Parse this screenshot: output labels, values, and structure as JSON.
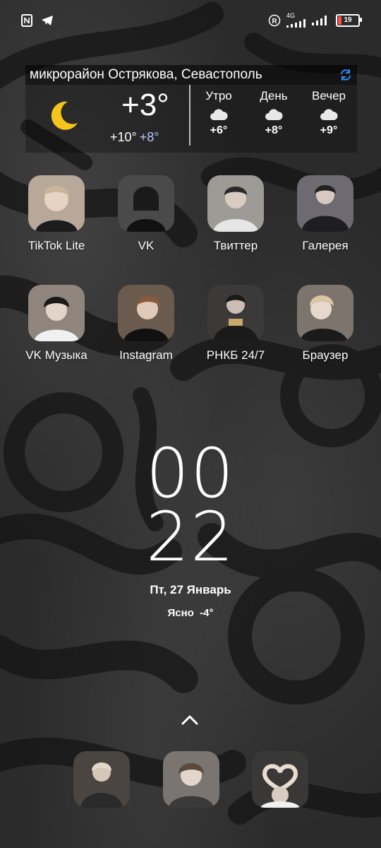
{
  "status_bar": {
    "left_icons": [
      "nfc-icon",
      "telegram-icon"
    ],
    "network_label": "4G",
    "battery_level": 19,
    "battery_text": "19"
  },
  "weather": {
    "location": "микрорайон Острякова, Севастополь",
    "current_temp": "+3°",
    "temp_high": "+10°",
    "temp_low": "+8°",
    "forecast": [
      {
        "label": "Утро",
        "temp": "+6°"
      },
      {
        "label": "День",
        "temp": "+8°"
      },
      {
        "label": "Вечер",
        "temp": "+9°"
      }
    ]
  },
  "apps": [
    {
      "label": "TikTok Lite",
      "color": "#b8a89a"
    },
    {
      "label": "VK",
      "color": "#4a4a4a"
    },
    {
      "label": "Твиттер",
      "color": "#9e9a96"
    },
    {
      "label": "Галерея",
      "color": "#6e6a72"
    },
    {
      "label": "VK Музыка",
      "color": "#8f857c"
    },
    {
      "label": "Instagram",
      "color": "#6b5a4e"
    },
    {
      "label": "РНКБ 24/7",
      "color": "#3c3a38"
    },
    {
      "label": "Браузер",
      "color": "#7d746d"
    }
  ],
  "clock": {
    "hours": "00",
    "minutes": "22",
    "date": "Пт, 27 Январь",
    "weather": "Ясно  -4°"
  },
  "dock": [
    {
      "name": "dock-app-1",
      "color": "#4a4540"
    },
    {
      "name": "dock-app-2",
      "color": "#7a7570"
    },
    {
      "name": "dock-app-3",
      "color": "#3a3836"
    }
  ]
}
